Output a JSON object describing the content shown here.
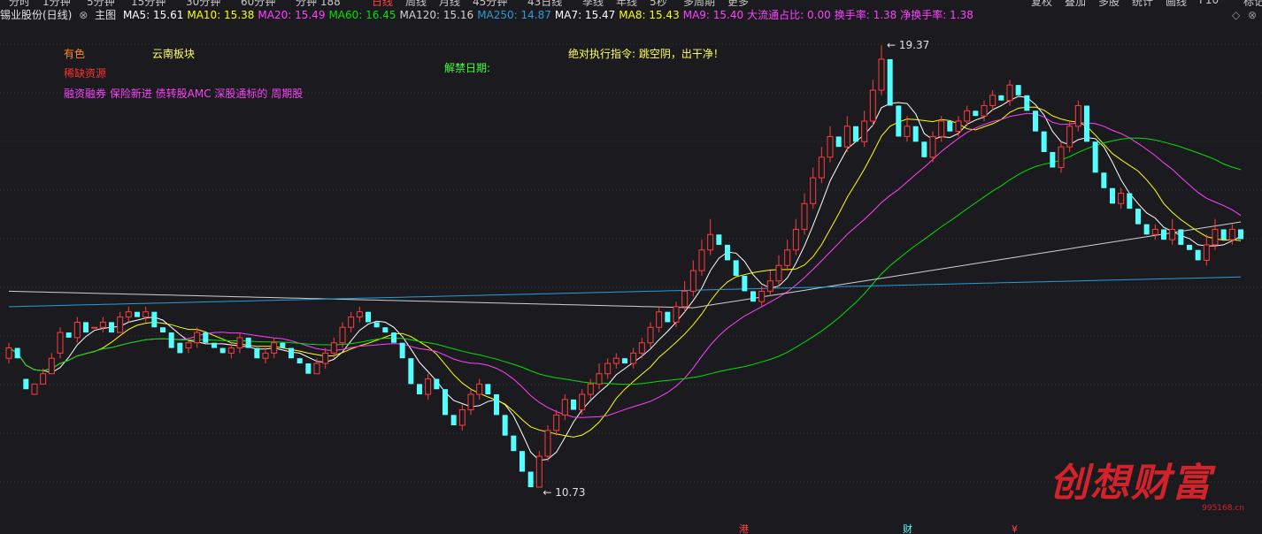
{
  "toolbar_partial": [
    "分时",
    "1分钟",
    "5分钟",
    "15分钟",
    "30分钟",
    "60分钟",
    "分钟 188",
    "日线",
    "周线",
    "月线",
    "45分钟",
    "43日线",
    "季线",
    "年线",
    "5秒",
    "多周期",
    "更多"
  ],
  "right_toolbar_partial": [
    "复权",
    "叠加",
    "多股",
    "统计",
    "画线",
    "F10",
    "标记"
  ],
  "stock_title": "锡业股份(日线)",
  "main_label": "主图",
  "indicators": [
    {
      "text": "MA5: 15.61",
      "color": "#ffffff"
    },
    {
      "text": "MA10: 15.38",
      "color": "#ffff00"
    },
    {
      "text": "MA20: 15.49",
      "color": "#ff40ff"
    },
    {
      "text": "MA60: 16.45",
      "color": "#00e000"
    },
    {
      "text": "MA120: 15.16",
      "color": "#d0d0d0"
    },
    {
      "text": "MA250: 14.87",
      "color": "#2a9bd8"
    },
    {
      "text": "MA7: 15.47",
      "color": "#ffffff"
    },
    {
      "text": "MA8: 15.43",
      "color": "#ffff00"
    },
    {
      "text": "MA9: 15.40",
      "color": "#ff40ff"
    },
    {
      "text": "大流通占比: 0.00",
      "color": "#ff40ff"
    },
    {
      "text": "换手率: 1.38",
      "color": "#ff40ff"
    },
    {
      "text": "净换手率: 1.38",
      "color": "#ff40ff"
    }
  ],
  "annotations": {
    "sector": "有色",
    "region": "云南板块",
    "concept": "稀缺资源",
    "unlock": "解禁日期:",
    "instruction": "绝对执行指令: 跳空阴，出干净！",
    "tags": "融资融券 保险新进 债转股AMC 深股通标的 周期股"
  },
  "bottom_markers": [
    "港",
    "财",
    "¥"
  ],
  "watermark": {
    "text": "创想财富",
    "url": "995168.cn"
  },
  "chart_data": {
    "type": "candlestick",
    "ylim": [
      10.2,
      19.7
    ],
    "high_label": "19.37",
    "low_label": "10.73",
    "colors": {
      "up": "#ff3c3c",
      "down": "#54ffff",
      "bg": "#1b1b1f",
      "grid": "#333340"
    },
    "candles": [
      [
        13.3,
        13.5,
        13.2,
        13.6
      ],
      [
        13.5,
        13.3,
        13.4,
        12.9
      ],
      [
        12.9,
        12.7,
        13.0,
        12.6
      ],
      [
        12.6,
        12.8,
        12.9,
        12.5
      ],
      [
        12.8,
        13.0,
        12.8,
        13.1
      ],
      [
        13.0,
        13.3,
        13.0,
        13.4
      ],
      [
        13.4,
        13.8,
        13.3,
        13.9
      ],
      [
        13.8,
        13.7,
        13.9,
        13.6
      ],
      [
        13.7,
        14.0,
        13.6,
        14.1
      ],
      [
        14.0,
        13.8,
        14.1,
        13.7
      ],
      [
        13.9,
        13.9,
        14.0,
        13.8
      ],
      [
        13.9,
        14.0,
        13.8,
        14.1
      ],
      [
        14.0,
        13.8,
        14.0,
        13.7
      ],
      [
        13.8,
        14.1,
        13.8,
        14.2
      ],
      [
        14.1,
        14.2,
        14.0,
        14.3
      ],
      [
        14.2,
        14.1,
        14.3,
        14.0
      ],
      [
        14.1,
        14.2,
        14.0,
        14.3
      ],
      [
        14.2,
        13.9,
        14.2,
        13.8
      ],
      [
        13.9,
        13.8,
        14.0,
        13.7
      ],
      [
        13.8,
        13.5,
        13.8,
        13.4
      ],
      [
        13.6,
        13.4,
        13.7,
        13.3
      ],
      [
        13.5,
        13.6,
        13.4,
        13.7
      ],
      [
        13.6,
        13.8,
        13.5,
        13.9
      ],
      [
        13.8,
        13.6,
        13.8,
        13.5
      ],
      [
        13.6,
        13.5,
        13.7,
        13.4
      ],
      [
        13.5,
        13.4,
        13.6,
        13.3
      ],
      [
        13.4,
        13.5,
        13.3,
        13.6
      ],
      [
        13.5,
        13.7,
        13.4,
        13.8
      ],
      [
        13.7,
        13.5,
        13.7,
        13.4
      ],
      [
        13.5,
        13.3,
        13.6,
        13.2
      ],
      [
        13.3,
        13.4,
        13.2,
        13.5
      ],
      [
        13.4,
        13.6,
        13.3,
        13.7
      ],
      [
        13.6,
        13.5,
        13.7,
        13.4
      ],
      [
        13.5,
        13.3,
        13.5,
        13.2
      ],
      [
        13.3,
        13.2,
        13.4,
        13.1
      ],
      [
        13.2,
        13.0,
        13.3,
        12.9
      ],
      [
        13.0,
        13.2,
        13.0,
        13.3
      ],
      [
        13.2,
        13.4,
        13.1,
        13.5
      ],
      [
        13.4,
        13.6,
        13.3,
        13.7
      ],
      [
        13.6,
        13.9,
        13.5,
        14.0
      ],
      [
        13.9,
        14.1,
        13.8,
        14.2
      ],
      [
        14.1,
        14.2,
        14.0,
        14.3
      ],
      [
        14.2,
        14.0,
        14.2,
        13.9
      ],
      [
        14.0,
        13.9,
        14.1,
        13.8
      ],
      [
        13.9,
        13.8,
        14.0,
        13.7
      ],
      [
        13.8,
        13.6,
        13.9,
        13.5
      ],
      [
        13.6,
        13.3,
        13.7,
        13.2
      ],
      [
        13.3,
        12.8,
        13.4,
        12.7
      ],
      [
        12.8,
        12.6,
        12.9,
        12.5
      ],
      [
        12.6,
        12.9,
        12.5,
        13.0
      ],
      [
        12.9,
        12.7,
        13.0,
        12.6
      ],
      [
        12.7,
        12.2,
        12.8,
        12.1
      ],
      [
        12.2,
        12.0,
        12.3,
        11.8
      ],
      [
        12.0,
        12.3,
        11.9,
        12.4
      ],
      [
        12.3,
        12.6,
        12.2,
        12.7
      ],
      [
        12.6,
        12.8,
        12.5,
        12.9
      ],
      [
        12.8,
        12.6,
        12.9,
        12.5
      ],
      [
        12.6,
        12.2,
        12.7,
        12.1
      ],
      [
        12.2,
        11.8,
        12.3,
        11.7
      ],
      [
        11.8,
        11.5,
        11.9,
        11.3
      ],
      [
        11.5,
        11.1,
        11.6,
        11.0
      ],
      [
        11.1,
        10.8,
        11.2,
        10.73
      ],
      [
        10.8,
        11.4,
        10.8,
        11.5
      ],
      [
        11.4,
        11.9,
        11.3,
        12.0
      ],
      [
        11.9,
        12.2,
        11.8,
        12.3
      ],
      [
        12.2,
        12.5,
        12.1,
        12.6
      ],
      [
        12.5,
        12.3,
        12.6,
        12.2
      ],
      [
        12.3,
        12.6,
        12.2,
        12.7
      ],
      [
        12.6,
        12.8,
        12.5,
        12.9
      ],
      [
        12.8,
        13.0,
        12.7,
        13.2
      ],
      [
        13.0,
        13.2,
        12.9,
        13.3
      ],
      [
        13.2,
        13.3,
        13.1,
        13.4
      ],
      [
        13.3,
        13.2,
        13.4,
        13.1
      ],
      [
        13.2,
        13.4,
        13.1,
        13.5
      ],
      [
        13.4,
        13.6,
        13.3,
        13.7
      ],
      [
        13.6,
        13.9,
        13.5,
        14.0
      ],
      [
        13.9,
        14.2,
        13.8,
        14.3
      ],
      [
        14.2,
        14.0,
        14.3,
        13.9
      ],
      [
        14.0,
        14.3,
        13.9,
        14.4
      ],
      [
        14.3,
        14.6,
        14.2,
        14.8
      ],
      [
        14.6,
        15.0,
        14.5,
        15.2
      ],
      [
        15.0,
        15.4,
        14.9,
        15.6
      ],
      [
        15.4,
        15.7,
        15.3,
        16.0
      ],
      [
        15.7,
        15.5,
        15.8,
        15.3
      ],
      [
        15.5,
        15.2,
        15.6,
        15.1
      ],
      [
        15.2,
        14.9,
        15.3,
        14.8
      ],
      [
        14.9,
        14.6,
        15.0,
        14.5
      ],
      [
        14.6,
        14.4,
        14.7,
        14.2
      ],
      [
        14.4,
        14.6,
        14.3,
        14.7
      ],
      [
        14.6,
        14.8,
        14.5,
        15.0
      ],
      [
        14.8,
        15.1,
        14.7,
        15.3
      ],
      [
        15.1,
        15.4,
        15.0,
        15.6
      ],
      [
        15.4,
        15.8,
        15.3,
        16.0
      ],
      [
        15.8,
        16.3,
        15.7,
        16.5
      ],
      [
        16.3,
        16.8,
        16.2,
        17.0
      ],
      [
        16.8,
        17.2,
        16.7,
        17.4
      ],
      [
        17.2,
        17.6,
        17.1,
        17.8
      ],
      [
        17.6,
        17.4,
        17.7,
        17.3
      ],
      [
        17.4,
        17.8,
        17.3,
        18.0
      ],
      [
        17.8,
        17.5,
        17.9,
        17.3
      ],
      [
        17.5,
        17.9,
        17.4,
        18.1
      ],
      [
        17.9,
        18.5,
        17.8,
        18.7
      ],
      [
        18.5,
        19.1,
        18.4,
        19.37
      ],
      [
        19.1,
        18.2,
        19.2,
        18.0
      ],
      [
        18.2,
        17.6,
        18.3,
        17.4
      ],
      [
        17.6,
        17.8,
        17.5,
        18.0
      ],
      [
        17.8,
        17.5,
        17.9,
        17.4
      ],
      [
        17.5,
        17.2,
        17.6,
        17.1
      ],
      [
        17.2,
        17.6,
        17.1,
        17.7
      ],
      [
        17.6,
        17.9,
        17.5,
        18.0
      ],
      [
        17.9,
        17.7,
        18.0,
        17.6
      ],
      [
        17.7,
        17.9,
        17.6,
        18.0
      ],
      [
        17.9,
        18.1,
        17.8,
        18.2
      ],
      [
        18.1,
        18.0,
        18.2,
        17.9
      ],
      [
        18.0,
        18.2,
        17.9,
        18.3
      ],
      [
        18.2,
        18.4,
        18.1,
        18.5
      ],
      [
        18.4,
        18.3,
        18.5,
        18.1
      ],
      [
        18.3,
        18.6,
        18.2,
        18.7
      ],
      [
        18.6,
        18.4,
        18.7,
        18.3
      ],
      [
        18.4,
        18.1,
        18.5,
        17.9
      ],
      [
        18.1,
        17.7,
        18.2,
        17.5
      ],
      [
        17.7,
        17.3,
        17.8,
        17.2
      ],
      [
        17.3,
        17.0,
        17.4,
        16.9
      ],
      [
        17.0,
        17.4,
        16.9,
        17.5
      ],
      [
        17.4,
        17.8,
        17.3,
        17.9
      ],
      [
        17.8,
        18.2,
        17.7,
        18.3
      ],
      [
        18.2,
        17.5,
        18.3,
        17.4
      ],
      [
        17.5,
        16.9,
        17.6,
        16.8
      ],
      [
        16.9,
        16.6,
        17.0,
        16.5
      ],
      [
        16.6,
        16.3,
        16.7,
        16.2
      ],
      [
        16.3,
        16.5,
        16.2,
        16.6
      ],
      [
        16.5,
        16.2,
        16.6,
        16.1
      ],
      [
        16.2,
        15.9,
        16.3,
        15.8
      ],
      [
        15.9,
        15.7,
        16.0,
        15.6
      ],
      [
        15.7,
        15.8,
        15.6,
        15.9
      ],
      [
        15.8,
        15.6,
        15.9,
        15.5
      ],
      [
        15.6,
        15.8,
        15.5,
        16.0
      ],
      [
        15.8,
        15.5,
        15.9,
        15.4
      ],
      [
        15.5,
        15.4,
        15.6,
        15.3
      ],
      [
        15.4,
        15.2,
        15.5,
        15.0
      ],
      [
        15.2,
        15.5,
        15.1,
        15.7
      ],
      [
        15.5,
        15.8,
        15.4,
        16.0
      ],
      [
        15.8,
        15.6,
        15.9,
        15.5
      ],
      [
        15.6,
        15.8,
        15.5,
        15.9
      ],
      [
        15.8,
        15.61,
        15.9,
        15.4
      ]
    ],
    "ma_series": [
      {
        "name": "MA5",
        "color": "#ffffff"
      },
      {
        "name": "MA10",
        "color": "#ffff00"
      },
      {
        "name": "MA20",
        "color": "#ff40ff"
      },
      {
        "name": "MA60",
        "color": "#00e000"
      },
      {
        "name": "MA120",
        "color": "#d0d0d0"
      },
      {
        "name": "MA250",
        "color": "#2a9bd8"
      }
    ]
  }
}
